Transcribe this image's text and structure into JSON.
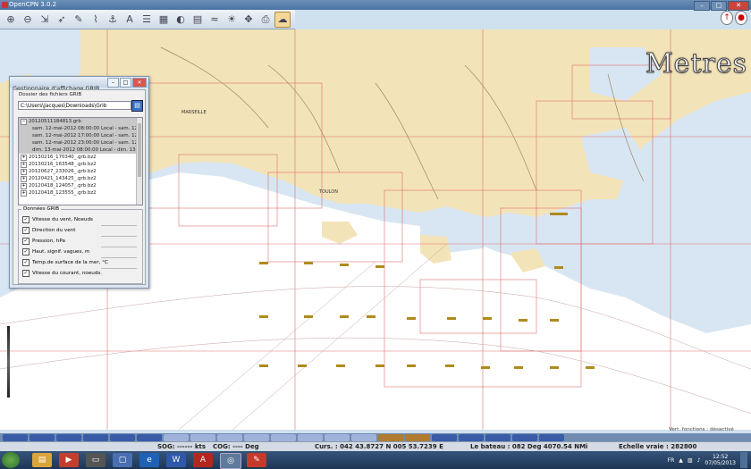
{
  "window": {
    "title": "OpenCPN 3.0.2"
  },
  "toolbar": {
    "icons": [
      "zoom-in-icon",
      "zoom-out-icon",
      "scale-icon",
      "arrow-icon",
      "pencil-icon",
      "route-icon",
      "anchor-icon",
      "text-icon",
      "settings-icon",
      "chart-icon",
      "gauge-icon",
      "sheet-icon",
      "tide-icon",
      "sun-icon",
      "current-icon",
      "print-icon",
      "grib-icon"
    ],
    "active_index": 16
  },
  "overlay": {
    "unit_label": "Metres"
  },
  "grib_panel": {
    "title": "Gestionnaire d'affichage GRIB",
    "folder_label": "Dossier des fichiers GRIB",
    "folder_path": "C:\\Users\\Jacques\\Downloads\\Grib",
    "tree": [
      {
        "label": "20120511184813.grb",
        "kind": "file",
        "expanded": true,
        "selected": true
      },
      {
        "label": "sam. 12-mai-2012 08:00:00 Local - sam. 12-ma",
        "kind": "record"
      },
      {
        "label": "sam. 12-mai-2012 17:00:00 Local - sam. 12-ma",
        "kind": "record"
      },
      {
        "label": "sam. 12-mai-2012 23:00:00 Local - sam. 12-ma",
        "kind": "record"
      },
      {
        "label": "dim. 13-mai-2012 08:00:00 Local - dim. 13-mai",
        "kind": "record"
      },
      {
        "label": "20130216_170340_.grb.bz2",
        "kind": "file"
      },
      {
        "label": "20130216_163548_.grb.bz2",
        "kind": "file"
      },
      {
        "label": "20120627_233026_.grb.bz2",
        "kind": "file"
      },
      {
        "label": "20120421_143425_.grb.bz2",
        "kind": "file"
      },
      {
        "label": "20120418_124057_.grb.bz2",
        "kind": "file"
      },
      {
        "label": "20120418_123555_.grb.bz2",
        "kind": "file"
      }
    ],
    "data_group_label": "Données GRIB",
    "options": [
      {
        "label": "Vitesse du vent, Noeuds",
        "checked": true
      },
      {
        "label": "Direction du vent",
        "checked": true
      },
      {
        "label": "Pression, hPa",
        "checked": true
      },
      {
        "label": "Haut. signif. vagues, m",
        "checked": true
      },
      {
        "label": "Temp.de surface de la mer, °C",
        "checked": true
      },
      {
        "label": "Vitesse du courant, noeuds.",
        "checked": true
      }
    ]
  },
  "chart_labels": {
    "marseille": "MARSEILLE",
    "toulon": "TOULON",
    "note": "Vert. fonctions : désactivé"
  },
  "status": {
    "sog": "SOG: ------ kts",
    "cog": "COG: ---- Deg",
    "cursor": "Curs. : 042 43.8727 N 005 53.7239 E",
    "bearing": "Le bateau : 082 Deg  4070.54 NMi",
    "scale": "Echelle vraie :   282800"
  },
  "taskbar": {
    "lang": "FR",
    "time": "12:52",
    "date": "07/05/2013"
  },
  "colors": {
    "land": "#f3e3b8",
    "shallow": "#dfe9f4",
    "deep": "#ffffff",
    "grid": "#e07070"
  }
}
